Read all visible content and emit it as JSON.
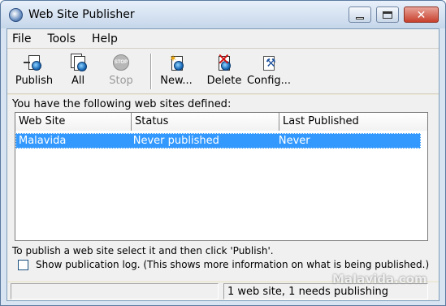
{
  "window": {
    "title": "Web Site Publisher"
  },
  "menu": {
    "items": [
      "File",
      "Tools",
      "Help"
    ]
  },
  "toolbar": {
    "buttons": [
      {
        "label": "Publish",
        "icon": "publish-icon",
        "enabled": true
      },
      {
        "label": "All",
        "icon": "publish-all-icon",
        "enabled": true
      },
      {
        "label": "Stop",
        "icon": "stop-icon",
        "enabled": false
      },
      {
        "label": "New...",
        "icon": "new-site-icon",
        "enabled": true
      },
      {
        "label": "Delete",
        "icon": "delete-icon",
        "enabled": true
      },
      {
        "label": "Config...",
        "icon": "config-icon",
        "enabled": true
      }
    ]
  },
  "main": {
    "sites_label": "You have the following web sites defined:",
    "columns": [
      "Web Site",
      "Status",
      "Last Published"
    ],
    "rows": [
      {
        "site": "Malavida",
        "status": "Never published",
        "last_published": "Never",
        "selected": true
      }
    ],
    "hint": "To publish a web site select it and then click 'Publish'.",
    "show_log": {
      "checked": false,
      "label": "Show publication log. (This shows more information on what is being published.)"
    }
  },
  "status": {
    "pane2": "1 web site, 1 needs publishing"
  },
  "watermark": "Malavida.com",
  "colors": {
    "selection": "#3399ff",
    "close_button": "#c8402c"
  }
}
